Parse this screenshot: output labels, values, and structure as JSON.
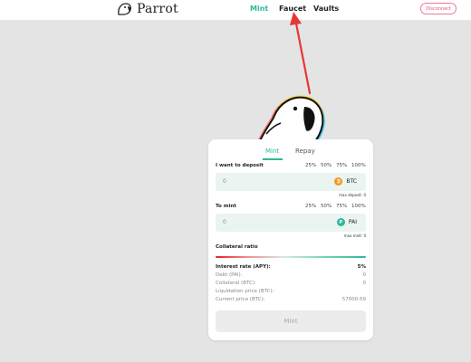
{
  "header": {
    "brand": "Parrot",
    "nav": [
      {
        "label": "Mint",
        "active": true
      },
      {
        "label": "Faucet",
        "active": false
      },
      {
        "label": "Vaults",
        "active": false
      }
    ],
    "disconnect_label": "Disconnect"
  },
  "panel": {
    "tabs": [
      {
        "label": "Mint",
        "active": true
      },
      {
        "label": "Repay",
        "active": false
      }
    ],
    "deposit": {
      "label": "I want to deposit",
      "percent_options": [
        "25%",
        "50%",
        "75%",
        "100%"
      ],
      "value": "0",
      "token": "BTC",
      "max_label": "max deposit: 0"
    },
    "mint": {
      "label": "To mint",
      "percent_options": [
        "25%",
        "50%",
        "75%",
        "100%"
      ],
      "value": "0",
      "token": "PAI",
      "max_label": "max mint: 0"
    },
    "collateral_label": "Collateral ratio",
    "info": [
      {
        "label": "Interest rate (APY):",
        "value": "5%"
      },
      {
        "label": "Debt (PAI):",
        "value": "0"
      },
      {
        "label": "Collateral (BTC):",
        "value": "0"
      },
      {
        "label": "Liquidation price (BTC):",
        "value": ""
      },
      {
        "label": "Current price (BTC):",
        "value": "57000.69"
      }
    ],
    "submit_label": "Mint"
  },
  "colors": {
    "accent": "#2fb79a",
    "disconnect": "#e0567a",
    "btc": "#f7931a",
    "arrow": "#e53935",
    "background": "#e4e4e4"
  },
  "icons": {
    "logo": "parrot-logo-icon",
    "btc": "btc-coin-icon",
    "pai": "pai-coin-icon"
  }
}
